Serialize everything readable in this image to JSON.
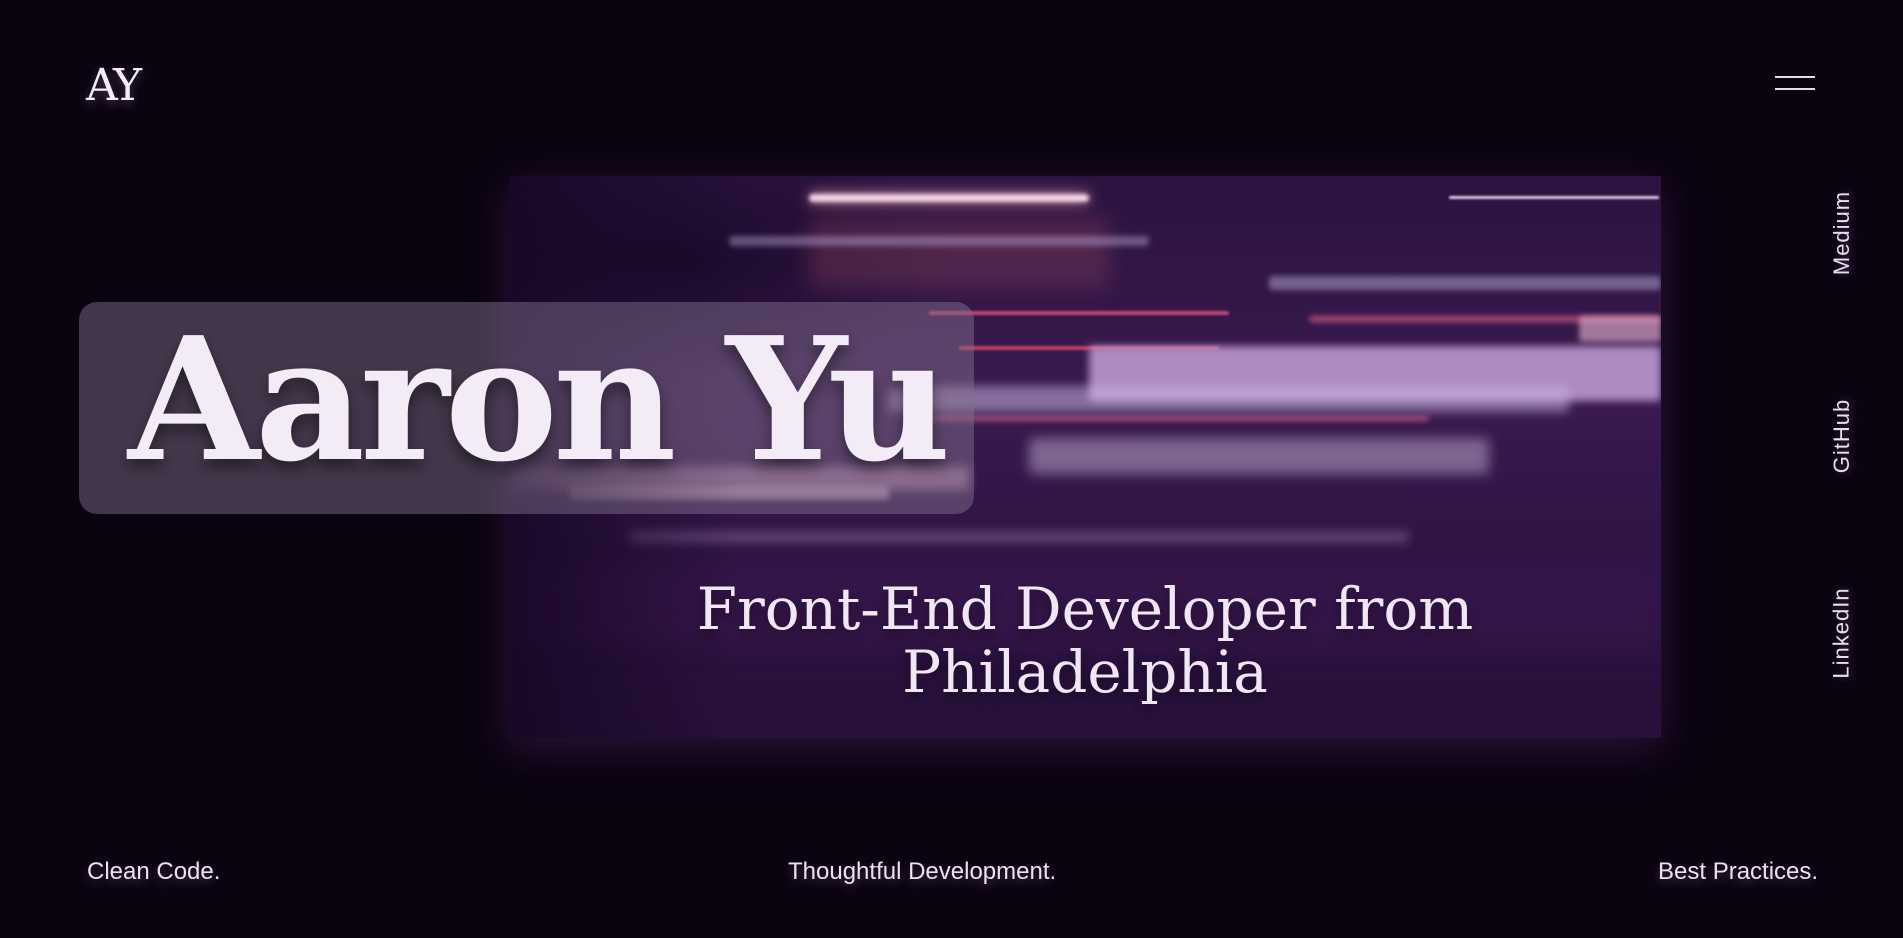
{
  "header": {
    "logo": "AY"
  },
  "hero": {
    "name": "Aaron Yu",
    "subtitle_line1": "Front-End Developer from",
    "subtitle_line2": "Philadelphia"
  },
  "social_links": [
    {
      "label": "Medium"
    },
    {
      "label": "GitHub"
    },
    {
      "label": "LinkedIn"
    }
  ],
  "taglines": {
    "left": "Clean Code.",
    "center": "Thoughtful Development.",
    "right": "Best Practices."
  },
  "colors": {
    "background": "#0a0310",
    "text": "#f1e6f3",
    "hero_tint": "#3a1a4f"
  }
}
